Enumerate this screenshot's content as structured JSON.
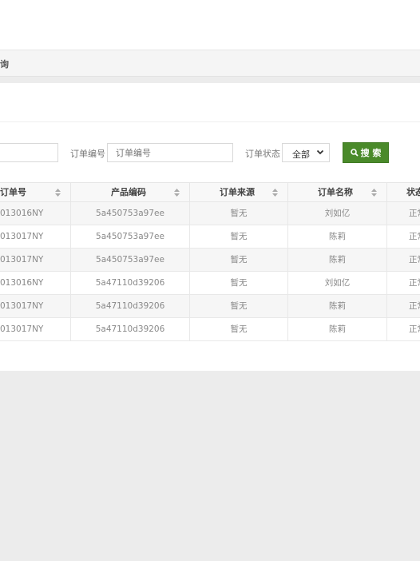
{
  "breadcrumb": {
    "text": "询"
  },
  "search_form": {
    "order_no_label": "订单编号",
    "order_no_placeholder": "订单编号",
    "status_label": "订单状态",
    "status_selected": "全部",
    "search_button": "搜 索"
  },
  "table": {
    "columns": [
      "订单号",
      "产品编码",
      "订单来源",
      "订单名称",
      "状态"
    ],
    "rows": [
      {
        "order_no": "013016NY",
        "product_code": "5a450753a97ee",
        "source": "暂无",
        "name": "刘如亿",
        "status": "正常"
      },
      {
        "order_no": "013017NY",
        "product_code": "5a450753a97ee",
        "source": "暂无",
        "name": "陈莉",
        "status": "正常"
      },
      {
        "order_no": "013017NY",
        "product_code": "5a450753a97ee",
        "source": "暂无",
        "name": "陈莉",
        "status": "正常"
      },
      {
        "order_no": "013016NY",
        "product_code": "5a47110d39206",
        "source": "暂无",
        "name": "刘如亿",
        "status": "正常"
      },
      {
        "order_no": "013017NY",
        "product_code": "5a47110d39206",
        "source": "暂无",
        "name": "陈莉",
        "status": "正常"
      },
      {
        "order_no": "013017NY",
        "product_code": "5a47110d39206",
        "source": "暂无",
        "name": "陈莉",
        "status": "正常"
      }
    ]
  },
  "colors": {
    "primary_button": "#4a8a2a",
    "header_bg": "#f8f8f8",
    "page_bg": "#ececec"
  }
}
